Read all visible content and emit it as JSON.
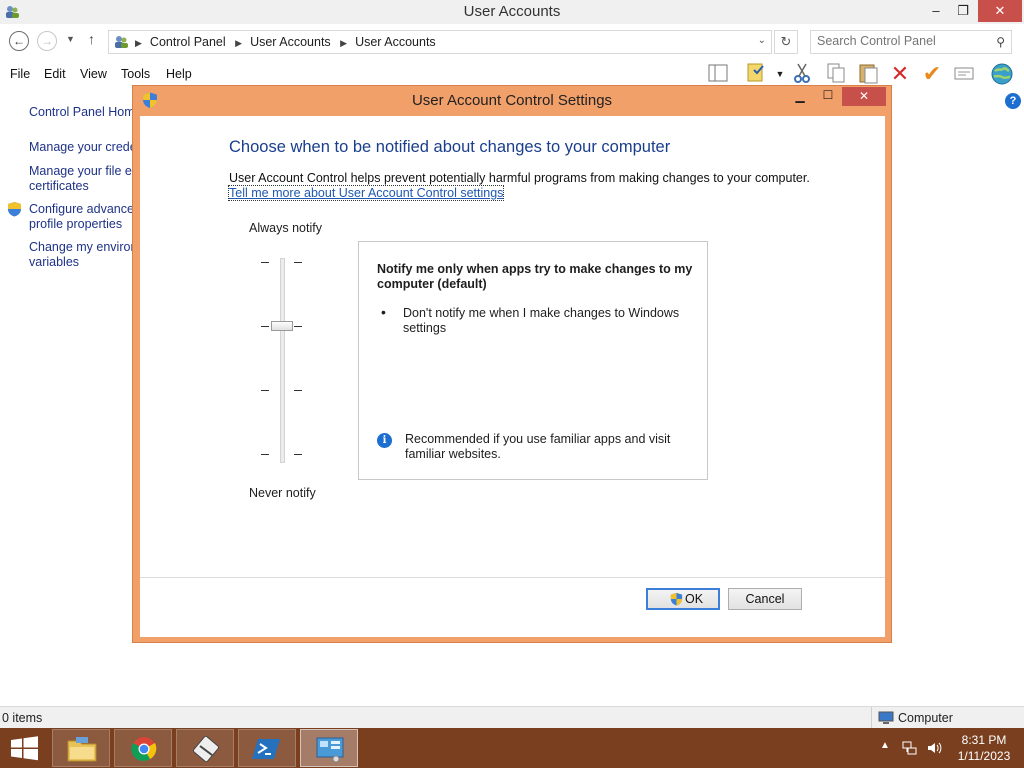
{
  "window": {
    "title": "User Accounts",
    "min": "–",
    "max": "❐",
    "close": "✕"
  },
  "address": {
    "crumbs": [
      "Control Panel",
      "User Accounts",
      "User Accounts"
    ],
    "search_placeholder": "Search Control Panel"
  },
  "menu": [
    "File",
    "Edit",
    "View",
    "Tools",
    "Help"
  ],
  "left_pane": {
    "home": "Control Panel Home",
    "link1": "Manage your credentials",
    "link2_line1": "Manage your file encryption",
    "link2_line2": "certificates",
    "link3_line1": "Configure advanced user",
    "link3_line2": "profile properties",
    "link4_line1": "Change my environment",
    "link4_line2": "variables"
  },
  "status": {
    "items": "0 items",
    "zone": "Computer"
  },
  "taskbar": {
    "time": "8:31 PM",
    "date": "1/11/2023"
  },
  "dialog": {
    "title": "User Account Control Settings",
    "heading": "Choose when to be notified about changes to your computer",
    "description": "User Account Control helps prevent potentially harmful programs from making changes to your computer.",
    "link": "Tell me more about User Account Control settings",
    "label_top": "Always notify",
    "label_bottom": "Never notify",
    "slider_level": 3,
    "slider_levels": 4,
    "info_title": "Notify me only when apps try to make changes to my computer (default)",
    "info_bullet": "Don't notify me when I make changes to Windows settings",
    "info_recommend": "Recommended if you use familiar apps and visit familiar websites.",
    "ok": "OK",
    "cancel": "Cancel"
  },
  "colors": {
    "accent": "#f2a06a",
    "taskbar": "#7a3f1f",
    "link": "#1e3287",
    "heading": "#1a3e8c"
  }
}
